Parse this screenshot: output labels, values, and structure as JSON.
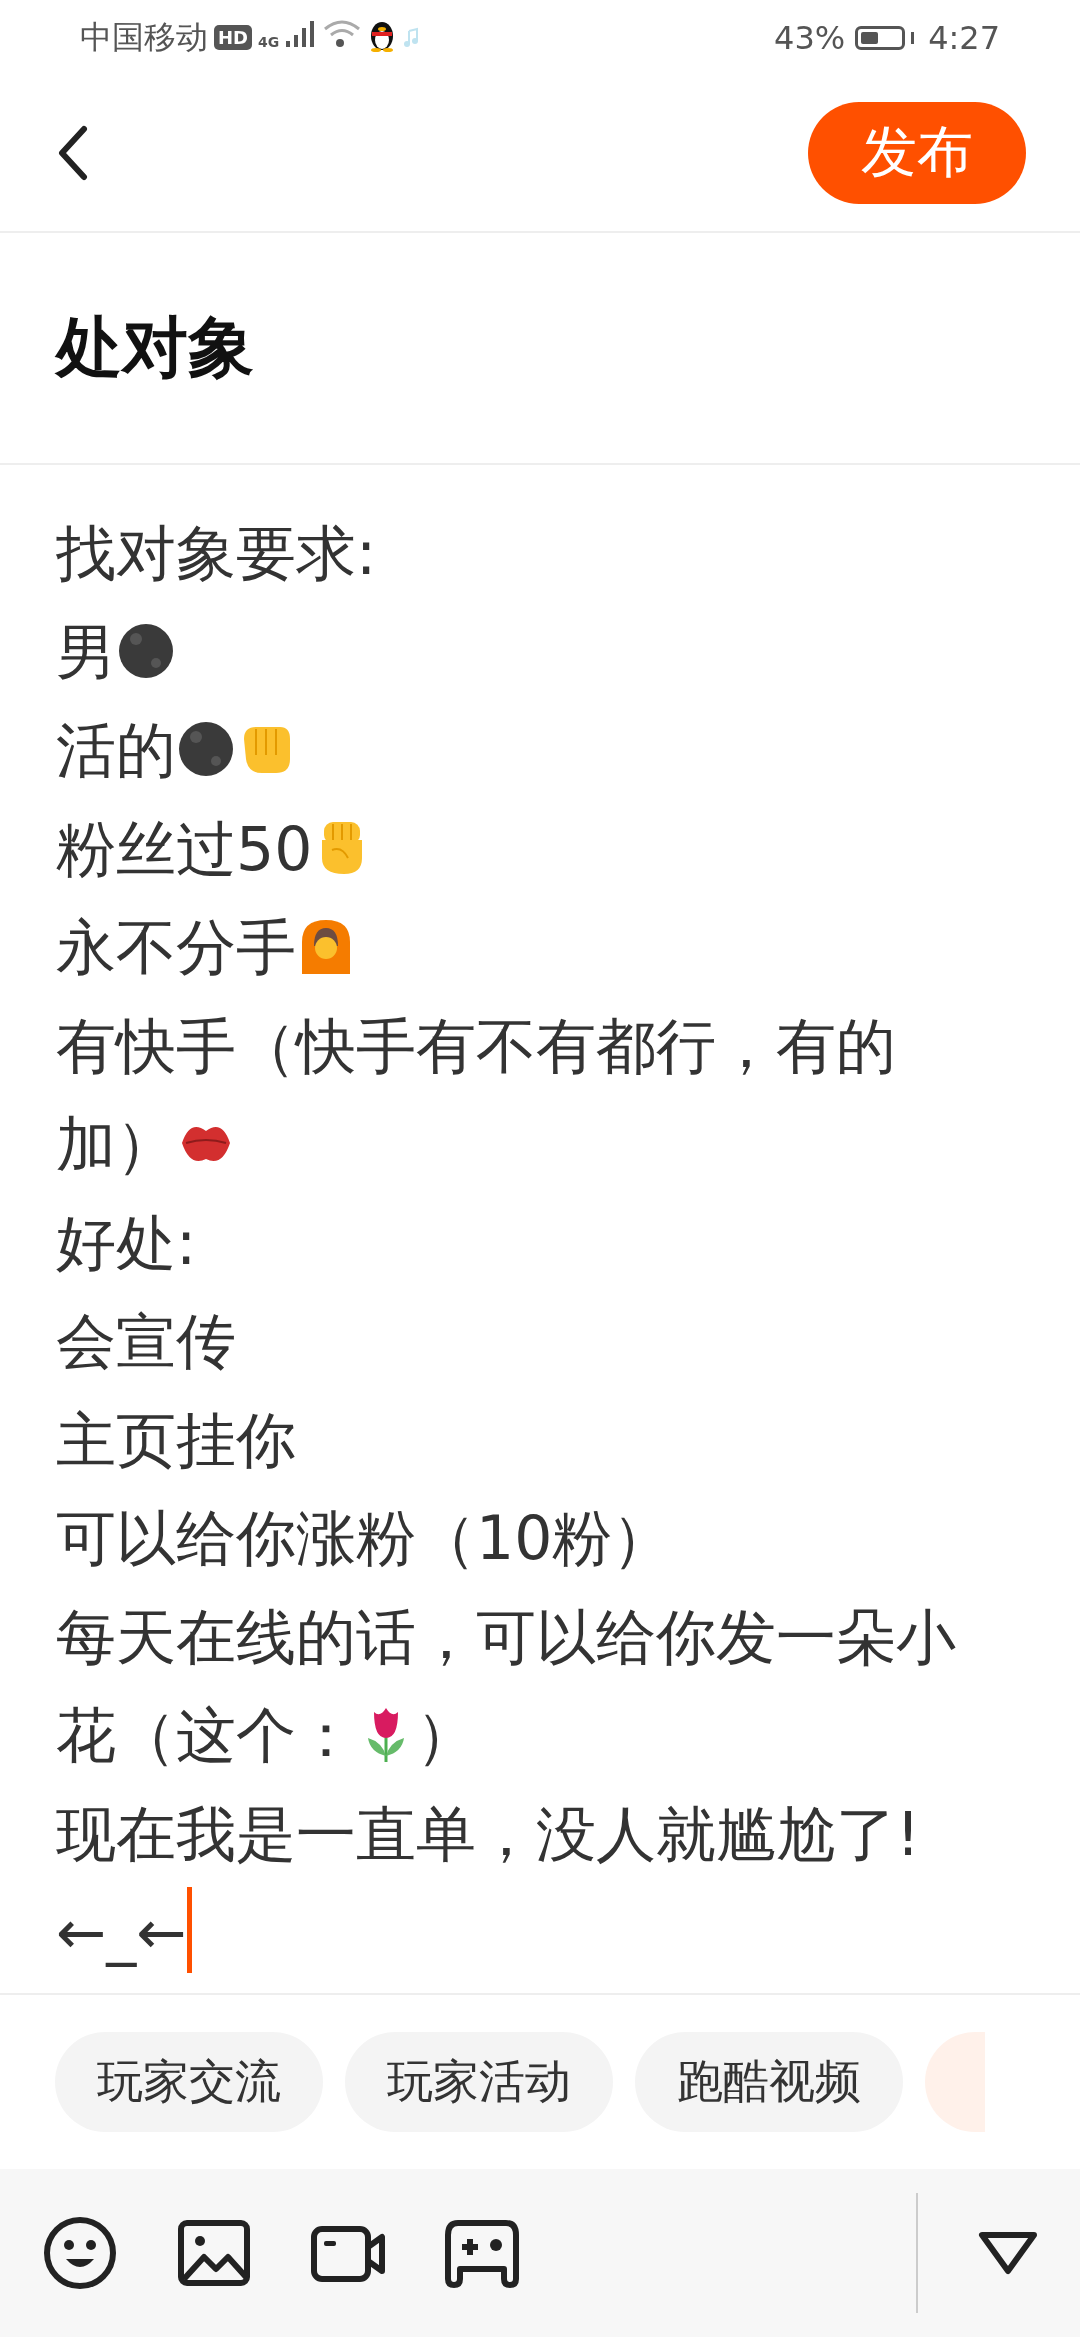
{
  "status_bar": {
    "carrier": "中国移动",
    "hd_badge": "HD",
    "network": "4G",
    "battery_percent": "43%",
    "time": "4:27"
  },
  "header": {
    "publish_button": "发布"
  },
  "title": "处对象",
  "body": {
    "lines": [
      [
        {
          "kind": "text",
          "text": "找对象要求:"
        }
      ],
      [
        {
          "kind": "text",
          "text": "男"
        },
        {
          "kind": "moon"
        }
      ],
      [
        {
          "kind": "text",
          "text": "活的"
        },
        {
          "kind": "moon"
        },
        {
          "kind": "punch"
        }
      ],
      [
        {
          "kind": "text",
          "text": "粉丝过50"
        },
        {
          "kind": "fist"
        }
      ],
      [
        {
          "kind": "text",
          "text": "永不分手"
        },
        {
          "kind": "person"
        }
      ],
      [
        {
          "kind": "text",
          "text": "有快手（快手有不有都行，有的"
        }
      ],
      [
        {
          "kind": "text",
          "text": "加）"
        },
        {
          "kind": "lips"
        }
      ],
      [
        {
          "kind": "text",
          "text": "好处:"
        }
      ],
      [
        {
          "kind": "text",
          "text": "会宣传"
        }
      ],
      [
        {
          "kind": "text",
          "text": "主页挂你"
        }
      ],
      [
        {
          "kind": "text",
          "text": "可以给你涨粉（10粉）"
        }
      ],
      [
        {
          "kind": "text",
          "text": "每天在线的话，可以给你发一朵小"
        }
      ],
      [
        {
          "kind": "text",
          "text": "花（这个："
        },
        {
          "kind": "tulip"
        },
        {
          "kind": "text",
          "text": "）"
        }
      ],
      [
        {
          "kind": "text",
          "text": "现在我是一直单，没人就尴尬了!"
        }
      ],
      [
        {
          "kind": "text",
          "text": "←_←"
        },
        {
          "kind": "cursor"
        }
      ]
    ]
  },
  "topics": [
    {
      "label": "玩家交流"
    },
    {
      "label": "玩家活动"
    },
    {
      "label": "跑酷视频"
    }
  ]
}
